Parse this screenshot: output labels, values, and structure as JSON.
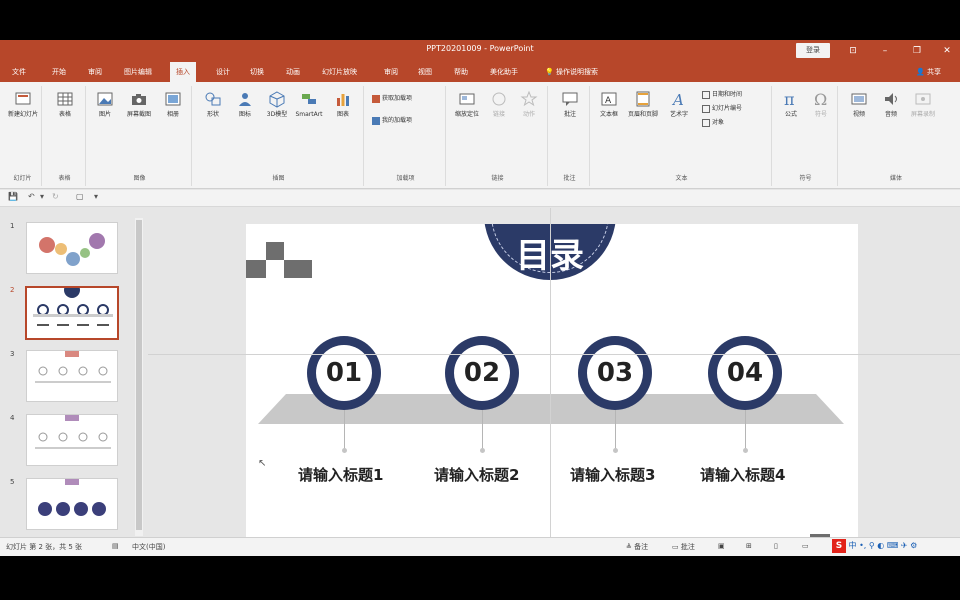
{
  "window": {
    "title": "PPT20201009 - PowerPoint",
    "signin_label": "登录",
    "accent_color": "#b7472a"
  },
  "tabs": [
    {
      "label": "文件"
    },
    {
      "label": "开始"
    },
    {
      "label": "审阅"
    },
    {
      "label": "图片编辑"
    },
    {
      "label": "插入",
      "active": true
    },
    {
      "label": "设计"
    },
    {
      "label": "切换"
    },
    {
      "label": "动画"
    },
    {
      "label": "幻灯片放映"
    },
    {
      "label": "审阅"
    },
    {
      "label": "视图"
    },
    {
      "label": "帮助"
    },
    {
      "label": "美化助手"
    }
  ],
  "tell_me": "操作说明搜索",
  "share_label": "共享",
  "ribbon": {
    "groups": [
      {
        "label": "幻灯片",
        "buttons": [
          "新建幻灯片"
        ]
      },
      {
        "label": "表格",
        "buttons": [
          "表格"
        ]
      },
      {
        "label": "图像",
        "buttons": [
          "图片",
          "屏幕截图",
          "相册"
        ]
      },
      {
        "label": "插图",
        "buttons": [
          "形状",
          "图标",
          "3D模型",
          "SmartArt",
          "图表"
        ]
      },
      {
        "label": "加载项",
        "buttons": [
          "获取加载项",
          "我的加载项"
        ]
      },
      {
        "label": "链接",
        "buttons": [
          "缩放定位",
          "链接",
          "动作"
        ]
      },
      {
        "label": "批注",
        "buttons": [
          "批注"
        ]
      },
      {
        "label": "文本",
        "buttons": [
          "文本框",
          "页眉和页脚",
          "艺术字",
          "日期和时间",
          "幻灯片编号",
          "对象"
        ]
      },
      {
        "label": "符号",
        "buttons": [
          "公式",
          "符号"
        ]
      },
      {
        "label": "媒体",
        "buttons": [
          "视频",
          "音频",
          "屏幕录制"
        ]
      }
    ]
  },
  "thumbnails": [
    {
      "num": "1"
    },
    {
      "num": "2"
    },
    {
      "num": "3"
    },
    {
      "num": "4"
    },
    {
      "num": "5"
    }
  ],
  "slide": {
    "title": "目录",
    "items": [
      {
        "num": "01",
        "heading": "请输入标题1"
      },
      {
        "num": "02",
        "heading": "请输入标题2"
      },
      {
        "num": "03",
        "heading": "请输入标题3"
      },
      {
        "num": "04",
        "heading": "请输入标题4"
      }
    ],
    "navy": "#2b3a67"
  },
  "status": {
    "slide_info": "幻灯片 第 2 张，共 5 张",
    "language": "中文(中国)",
    "notes": "备注",
    "comments": "批注"
  }
}
